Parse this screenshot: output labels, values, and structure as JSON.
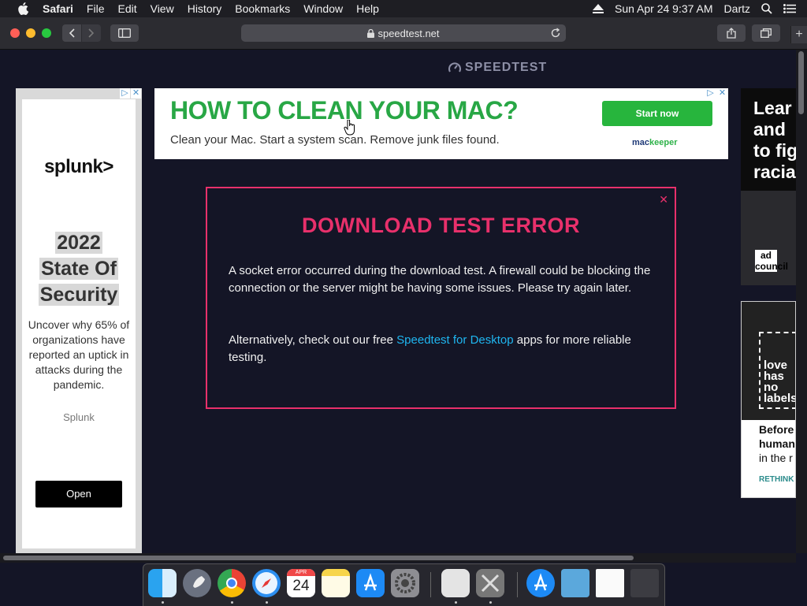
{
  "menubar": {
    "items": [
      "Safari",
      "File",
      "Edit",
      "View",
      "History",
      "Bookmarks",
      "Window",
      "Help"
    ],
    "datetime": "Sun Apr 24  9:37 AM",
    "user": "Dartz"
  },
  "toolbar": {
    "url": "speedtest.net"
  },
  "page": {
    "logo_text": "SPEEDTEST"
  },
  "left_ad": {
    "brand_logo": "splunk>",
    "headline": [
      "2022",
      "State Of",
      "Security"
    ],
    "body": "Uncover why 65% of organizations have reported an uptick in attacks during the pandemic.",
    "advertiser": "Splunk",
    "cta": "Open"
  },
  "banner_ad": {
    "headline": "HOW TO CLEAN YOUR MAC?",
    "subtext": "Clean your Mac. Start a system scan. Remove junk files found.",
    "cta": "Start now",
    "brand_a": "mac",
    "brand_b": "keeper"
  },
  "dialog": {
    "title": "DOWNLOAD TEST ERROR",
    "message": "A socket error occurred during the download test. A firewall could be blocking the connection or the server might be having some issues. Please try again later.",
    "alt_prefix": "Alternatively, check out our free ",
    "alt_link": "Speedtest for Desktop",
    "alt_suffix": " apps for more reliable testing."
  },
  "right_ad1": {
    "lines": [
      "Lear",
      "and",
      "to fig",
      "racia"
    ],
    "logo": "ad council"
  },
  "right_ad2": {
    "image_text": [
      "love",
      "has",
      "no",
      "labels"
    ],
    "lines": [
      "Before",
      "human",
      "in the r"
    ],
    "tag": "RETHINK"
  },
  "dock": {
    "calendar_month": "APR",
    "calendar_day": "24"
  },
  "colors": {
    "accent_error": "#e8306b",
    "link": "#1fb6f0",
    "banner_green": "#28a745"
  }
}
